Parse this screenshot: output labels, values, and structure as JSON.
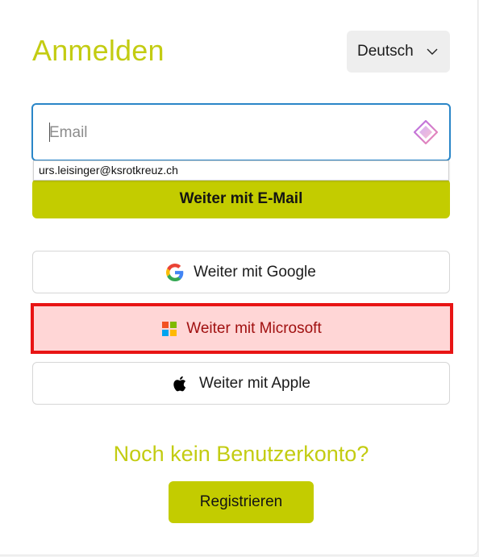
{
  "header": {
    "title": "Anmelden",
    "language": "Deutsch"
  },
  "email": {
    "placeholder": "Email",
    "value": "",
    "autocomplete_suggestion": "urs.leisinger@ksrotkreuz.ch"
  },
  "buttons": {
    "continue_email": "Weiter mit E-Mail",
    "google": "Weiter mit Google",
    "microsoft": "Weiter mit Microsoft",
    "apple": "Weiter mit Apple",
    "register": "Registrieren"
  },
  "footer": {
    "no_account": "Noch kein Benutzerkonto?"
  },
  "colors": {
    "accent": "#c3cc00",
    "focus_border": "#2a86c8",
    "highlight_border": "#e81414",
    "highlight_fill": "#ffd6d6"
  },
  "icons": {
    "language_chevron": "chevron-down-icon",
    "password_manager": "password-manager-icon",
    "google": "google-icon",
    "microsoft": "microsoft-icon",
    "apple": "apple-icon"
  }
}
